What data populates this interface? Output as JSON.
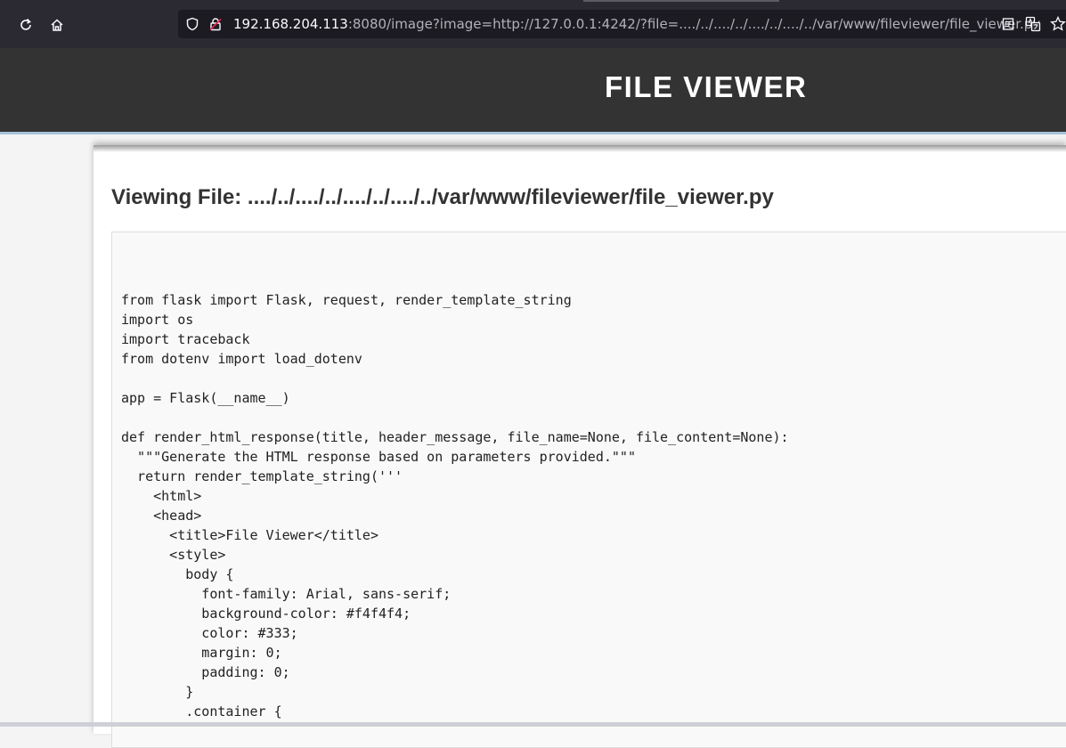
{
  "browser": {
    "url_host": "192.168.204.113",
    "url_rest": ":8080/image?image=http://127.0.0.1:4242/?file=..../../..../../..../../..../../var/www/fileviewer/file_viewer.py"
  },
  "header": {
    "title": "FILE VIEWER"
  },
  "main": {
    "viewing_title": "Viewing File: ..../../..../../..../../..../../var/www/fileviewer/file_viewer.py",
    "code": "from flask import Flask, request, render_template_string\nimport os\nimport traceback\nfrom dotenv import load_dotenv\n\napp = Flask(__name__)\n\ndef render_html_response(title, header_message, file_name=None, file_content=None):\n  \"\"\"Generate the HTML response based on parameters provided.\"\"\"\n  return render_template_string('''\n    <html>\n    <head>\n      <title>File Viewer</title>\n      <style>\n        body {\n          font-family: Arial, sans-serif;\n          background-color: #f4f4f4;\n          color: #333;\n          margin: 0;\n          padding: 0;\n        }\n        .container {"
  },
  "icons": {
    "reload": "reload-icon",
    "home": "home-icon",
    "shield": "shield-icon",
    "lock": "insecure-lock-icon",
    "reader": "reader-view-icon",
    "translate": "translate-icon",
    "bookmark": "bookmark-star-icon"
  },
  "colors": {
    "header_bg": "#333333",
    "header_border": "#a8c3db",
    "page_bg": "#f4f4f4",
    "code_bg": "#f9f9f9"
  }
}
